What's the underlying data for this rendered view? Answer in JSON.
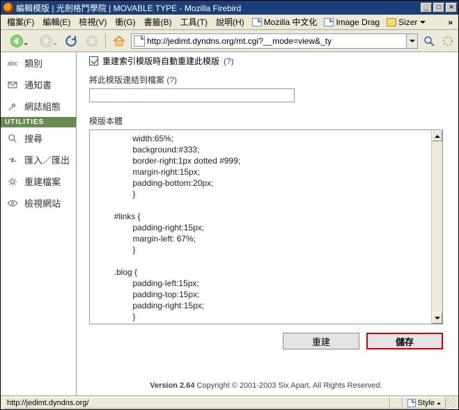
{
  "window": {
    "title": "編輯模版 | 光劍格鬥學院 | MOVABLE TYPE - Mozilla Firebird"
  },
  "menus": {
    "file": "檔案(F)",
    "edit": "編輯(E)",
    "view": "檢視(V)",
    "go": "衝(G)",
    "bookmarks": "書籤(B)",
    "tools": "工具(T)",
    "help": "說明(H)"
  },
  "bookmarks_bar": {
    "mozilla_zh": "Mozilla 中文化",
    "image_drag": "Image Drag",
    "sizer": "Sizer"
  },
  "url": {
    "value": "http://jedimt.dyndns.org/mt.cgi?__mode=view&_ty"
  },
  "sidebar": {
    "items": [
      {
        "label": "類別"
      },
      {
        "label": "通知書"
      },
      {
        "label": "網誌組態"
      }
    ],
    "utilities_header": "UTILITIES",
    "util_items": [
      {
        "label": "搜尋"
      },
      {
        "label": "匯入／匯出"
      },
      {
        "label": "重建檔案"
      },
      {
        "label": "檢視網站"
      }
    ]
  },
  "main": {
    "auto_rebuild_label": "重建索引模版時自動重建此模版",
    "help1": "(?)",
    "link_file_label": "將此模版連結到檔案",
    "help2": "(?)",
    "link_file_value": "",
    "template_body_label": "模版本體",
    "template_body_value": "\t\twidth:65%;\n\t\tbackground:#333;\n\t\tborder-right:1px dotted #999;\n\t\tmargin-right:15px;\n\t\tpadding-bottom:20px;\n\t\t}\n\n\t#links {\n\t\tpadding-right:15px;\n\t\tmargin-left: 67%;\n\t\t}\n\n\t.blog {\n\t\tpadding-left:15px;\n\t\tpadding-top:15px;\n\t\tpadding-right:15px;\t\t\t\n\t\t}\t\n\n\t.blogbody {\n\t\tfont-family:verdana, arial, sans-serif;",
    "rebuild_btn": "重建",
    "save_btn": "儲存"
  },
  "footer": {
    "version_label": "Version 2.64",
    "copyright": " Copyright © 2001-2003 Six Apart. All Rights Reserved."
  },
  "status": {
    "text": "http://jedimt.dyndns.org/",
    "style_label": "Style"
  }
}
